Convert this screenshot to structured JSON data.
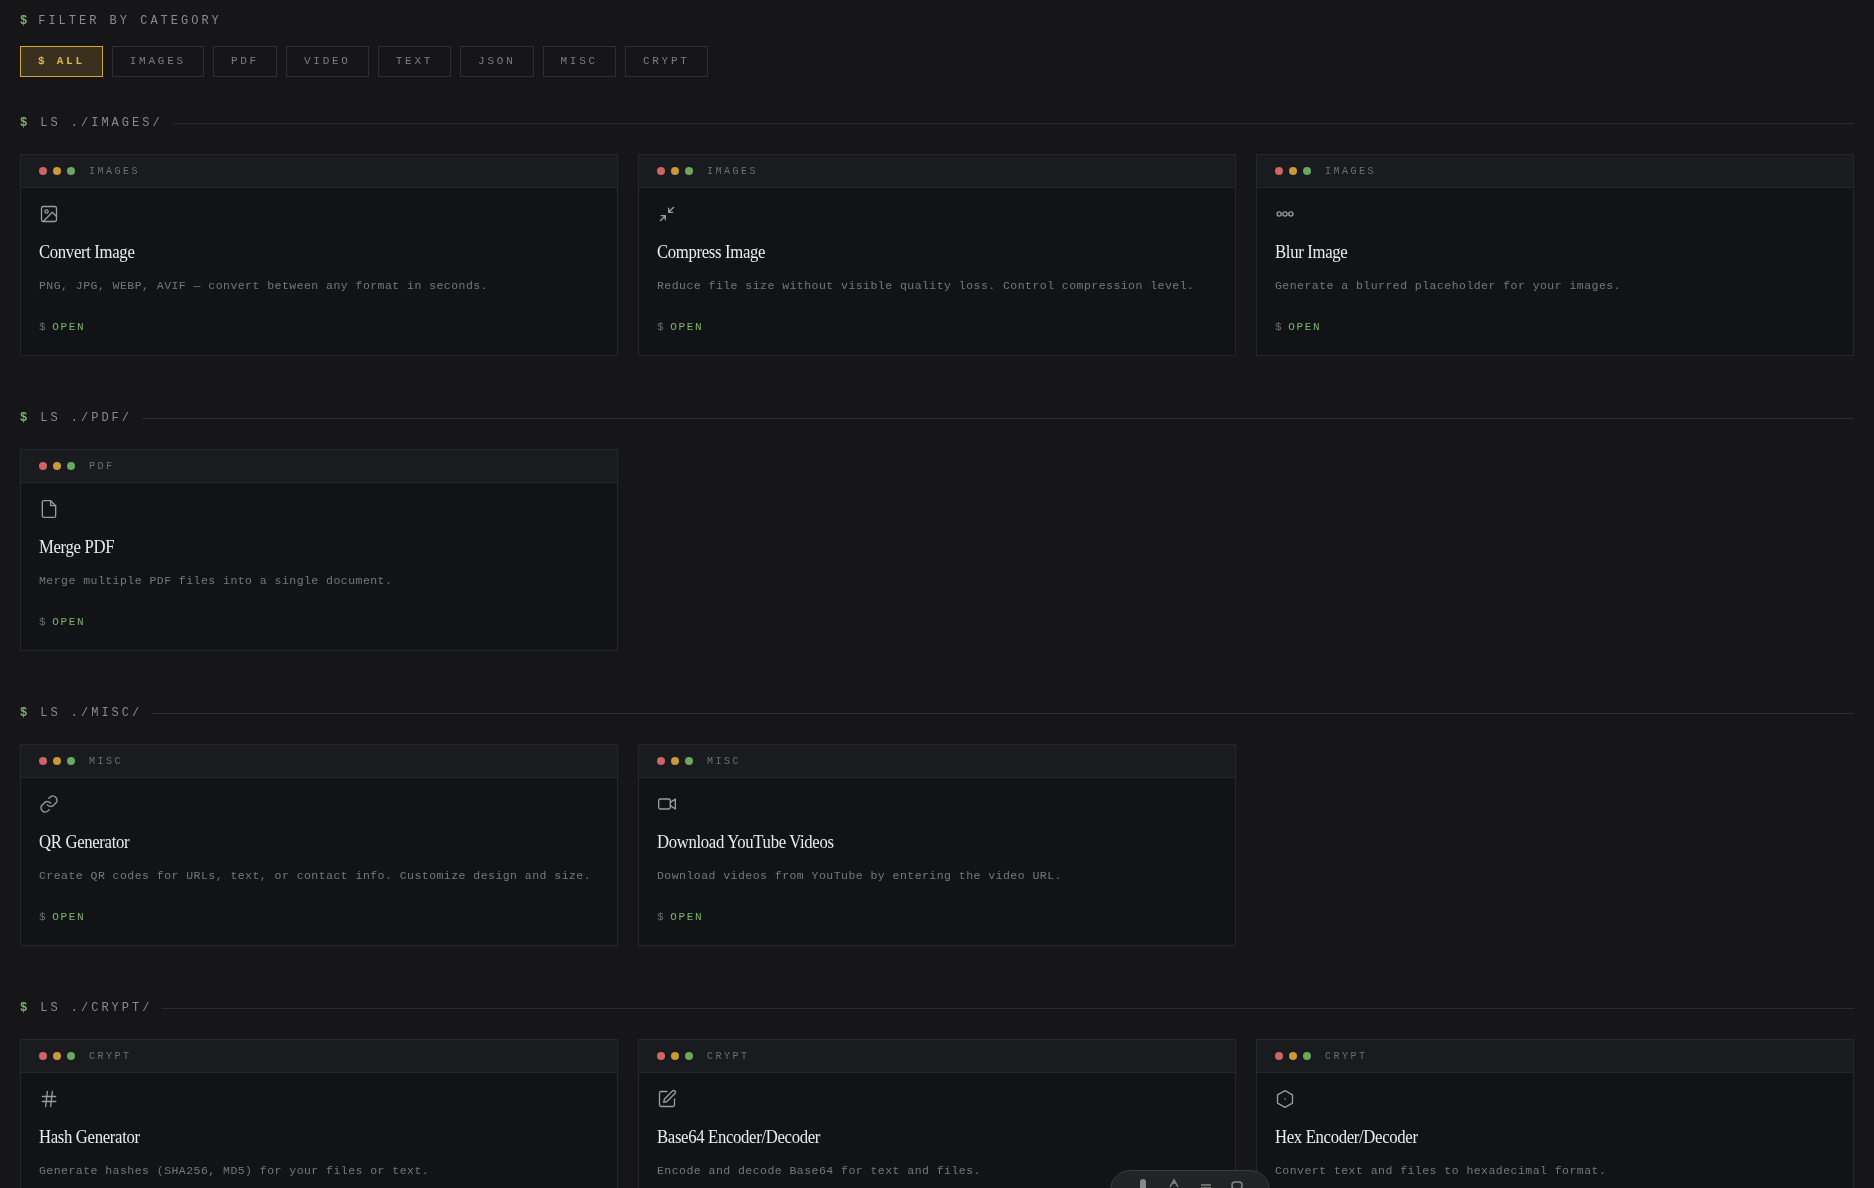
{
  "filter": {
    "prompt": "$",
    "label": "FILTER BY CATEGORY",
    "options": [
      {
        "label": "$ ALL",
        "selected": true
      },
      {
        "label": "IMAGES",
        "selected": false
      },
      {
        "label": "PDF",
        "selected": false
      },
      {
        "label": "VIDEO",
        "selected": false
      },
      {
        "label": "TEXT",
        "selected": false
      },
      {
        "label": "JSON",
        "selected": false
      },
      {
        "label": "MISC",
        "selected": false
      },
      {
        "label": "CRYPT",
        "selected": false
      }
    ]
  },
  "sections": [
    {
      "prompt": "$",
      "heading": "LS ./IMAGES/",
      "cards": [
        {
          "category": "IMAGES",
          "title": "Convert Image",
          "description": "PNG, JPG, WEBP, AVIF — convert between any format in seconds.",
          "action_prompt": "$",
          "action": "OPEN"
        },
        {
          "category": "IMAGES",
          "title": "Compress Image",
          "description": "Reduce file size without visible quality loss. Control compression level.",
          "action_prompt": "$",
          "action": "OPEN"
        },
        {
          "category": "IMAGES",
          "title": "Blur Image",
          "description": "Generate a blurred placeholder for your images.",
          "action_prompt": "$",
          "action": "OPEN"
        }
      ]
    },
    {
      "prompt": "$",
      "heading": "LS ./PDF/",
      "cards": [
        {
          "category": "PDF",
          "title": "Merge PDF",
          "description": "Merge multiple PDF files into a single document.",
          "action_prompt": "$",
          "action": "OPEN"
        }
      ]
    },
    {
      "prompt": "$",
      "heading": "LS ./MISC/",
      "cards": [
        {
          "category": "MISC",
          "title": "QR Generator",
          "description": "Create QR codes for URLs, text, or contact info. Customize design and size.",
          "action_prompt": "$",
          "action": "OPEN"
        },
        {
          "category": "MISC",
          "title": "Download YouTube Videos",
          "description": "Download videos from YouTube by entering the video URL.",
          "action_prompt": "$",
          "action": "OPEN"
        }
      ]
    },
    {
      "prompt": "$",
      "heading": "LS ./CRYPT/",
      "cards": [
        {
          "category": "CRYPT",
          "title": "Hash Generator",
          "description": "Generate hashes (SHA256, MD5) for your files or text."
        },
        {
          "category": "CRYPT",
          "title": "Base64 Encoder/Decoder",
          "description": "Encode and decode Base64 for text and files."
        },
        {
          "category": "CRYPT",
          "title": "Hex Encoder/Decoder",
          "description": "Convert text and files to hexadecimal format."
        }
      ]
    }
  ]
}
